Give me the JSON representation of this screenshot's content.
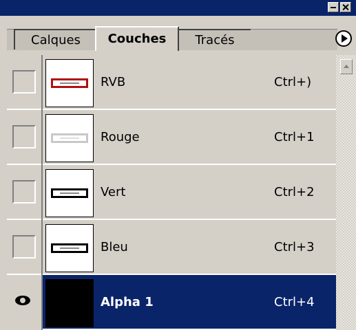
{
  "window": {
    "minimize_icon": "minimize-icon",
    "close_icon": "close-icon"
  },
  "tabs": [
    {
      "label": "Calques",
      "active": false
    },
    {
      "label": "Couches",
      "active": true
    },
    {
      "label": "Tracés",
      "active": false
    }
  ],
  "panel_menu_icon": "arrow-right-circle-icon",
  "channels": [
    {
      "name": "RVB",
      "shortcut": "Ctrl+)",
      "visible": false,
      "selected": false,
      "thumb": "red"
    },
    {
      "name": "Rouge",
      "shortcut": "Ctrl+1",
      "visible": false,
      "selected": false,
      "thumb": "ghost"
    },
    {
      "name": "Vert",
      "shortcut": "Ctrl+2",
      "visible": false,
      "selected": false,
      "thumb": "dark"
    },
    {
      "name": "Bleu",
      "shortcut": "Ctrl+3",
      "visible": false,
      "selected": false,
      "thumb": "dark"
    },
    {
      "name": "Alpha 1",
      "shortcut": "Ctrl+4",
      "visible": true,
      "selected": true,
      "thumb": "black"
    }
  ],
  "colors": {
    "titlebar": "#0a246a",
    "selected_row": "#0a246a",
    "panel_bg": "#d4d0c8",
    "rgb_thumb_border": "#b01010"
  }
}
